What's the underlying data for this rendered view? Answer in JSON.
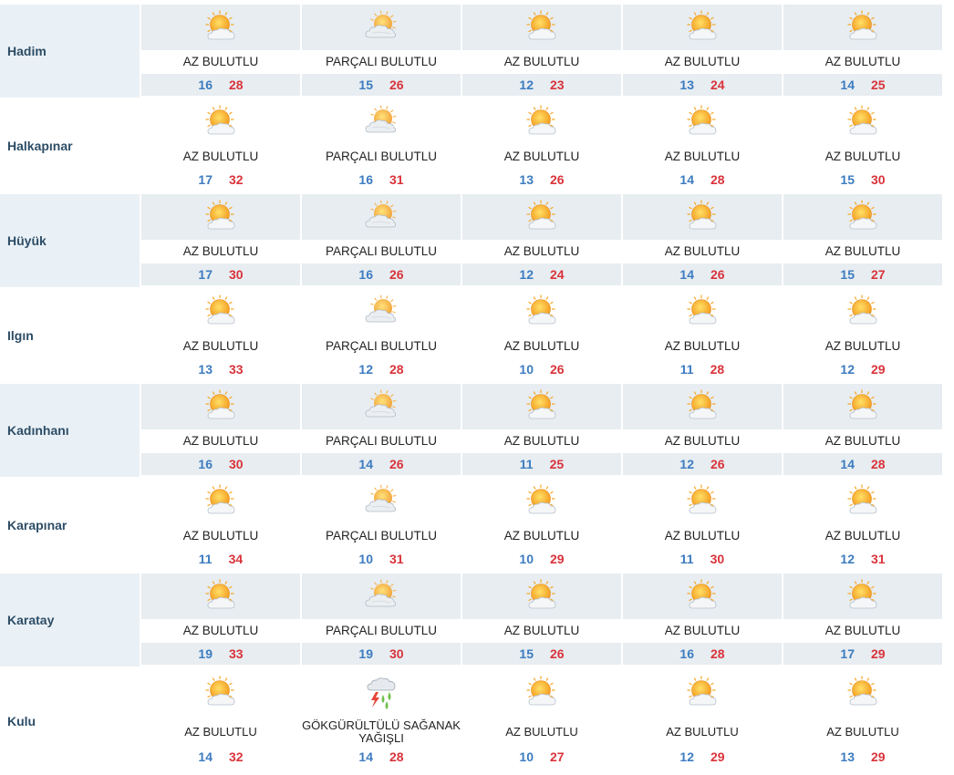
{
  "colors": {
    "min_temp": "#3d7cc0",
    "max_temp": "#d9333a",
    "city": "#2d4d66",
    "band": "#e7edf1"
  },
  "rows": [
    {
      "city": "Hadim",
      "days": [
        {
          "icon": "sun-cloud-icon",
          "desc": "AZ BULUTLU",
          "min": "16",
          "max": "28"
        },
        {
          "icon": "partly-cloudy-icon",
          "desc": "PARÇALI BULUTLU",
          "min": "15",
          "max": "26"
        },
        {
          "icon": "sun-cloud-icon",
          "desc": "AZ BULUTLU",
          "min": "12",
          "max": "23"
        },
        {
          "icon": "sun-cloud-icon",
          "desc": "AZ BULUTLU",
          "min": "13",
          "max": "24"
        },
        {
          "icon": "sun-cloud-icon",
          "desc": "AZ BULUTLU",
          "min": "14",
          "max": "25"
        }
      ]
    },
    {
      "city": "Halkapınar",
      "days": [
        {
          "icon": "sun-cloud-icon",
          "desc": "AZ BULUTLU",
          "min": "17",
          "max": "32"
        },
        {
          "icon": "partly-cloudy-icon",
          "desc": "PARÇALI BULUTLU",
          "min": "16",
          "max": "31"
        },
        {
          "icon": "sun-cloud-icon",
          "desc": "AZ BULUTLU",
          "min": "13",
          "max": "26"
        },
        {
          "icon": "sun-cloud-icon",
          "desc": "AZ BULUTLU",
          "min": "14",
          "max": "28"
        },
        {
          "icon": "sun-cloud-icon",
          "desc": "AZ BULUTLU",
          "min": "15",
          "max": "30"
        }
      ]
    },
    {
      "city": "Hüyük",
      "days": [
        {
          "icon": "sun-cloud-icon",
          "desc": "AZ BULUTLU",
          "min": "17",
          "max": "30"
        },
        {
          "icon": "partly-cloudy-icon",
          "desc": "PARÇALI BULUTLU",
          "min": "16",
          "max": "26"
        },
        {
          "icon": "sun-cloud-icon",
          "desc": "AZ BULUTLU",
          "min": "12",
          "max": "24"
        },
        {
          "icon": "sun-cloud-icon",
          "desc": "AZ BULUTLU",
          "min": "14",
          "max": "26"
        },
        {
          "icon": "sun-cloud-icon",
          "desc": "AZ BULUTLU",
          "min": "15",
          "max": "27"
        }
      ]
    },
    {
      "city": "Ilgın",
      "days": [
        {
          "icon": "sun-cloud-icon",
          "desc": "AZ BULUTLU",
          "min": "13",
          "max": "33"
        },
        {
          "icon": "partly-cloudy-icon",
          "desc": "PARÇALI BULUTLU",
          "min": "12",
          "max": "28"
        },
        {
          "icon": "sun-cloud-icon",
          "desc": "AZ BULUTLU",
          "min": "10",
          "max": "26"
        },
        {
          "icon": "sun-cloud-icon",
          "desc": "AZ BULUTLU",
          "min": "11",
          "max": "28"
        },
        {
          "icon": "sun-cloud-icon",
          "desc": "AZ BULUTLU",
          "min": "12",
          "max": "29"
        }
      ]
    },
    {
      "city": "Kadınhanı",
      "days": [
        {
          "icon": "sun-cloud-icon",
          "desc": "AZ BULUTLU",
          "min": "16",
          "max": "30"
        },
        {
          "icon": "partly-cloudy-icon",
          "desc": "PARÇALI BULUTLU",
          "min": "14",
          "max": "26"
        },
        {
          "icon": "sun-cloud-icon",
          "desc": "AZ BULUTLU",
          "min": "11",
          "max": "25"
        },
        {
          "icon": "sun-cloud-icon",
          "desc": "AZ BULUTLU",
          "min": "12",
          "max": "26"
        },
        {
          "icon": "sun-cloud-icon",
          "desc": "AZ BULUTLU",
          "min": "14",
          "max": "28"
        }
      ]
    },
    {
      "city": "Karapınar",
      "days": [
        {
          "icon": "sun-cloud-icon",
          "desc": "AZ BULUTLU",
          "min": "11",
          "max": "34"
        },
        {
          "icon": "partly-cloudy-icon",
          "desc": "PARÇALI BULUTLU",
          "min": "10",
          "max": "31"
        },
        {
          "icon": "sun-cloud-icon",
          "desc": "AZ BULUTLU",
          "min": "10",
          "max": "29"
        },
        {
          "icon": "sun-cloud-icon",
          "desc": "AZ BULUTLU",
          "min": "11",
          "max": "30"
        },
        {
          "icon": "sun-cloud-icon",
          "desc": "AZ BULUTLU",
          "min": "12",
          "max": "31"
        }
      ]
    },
    {
      "city": "Karatay",
      "days": [
        {
          "icon": "sun-cloud-icon",
          "desc": "AZ BULUTLU",
          "min": "19",
          "max": "33"
        },
        {
          "icon": "partly-cloudy-icon",
          "desc": "PARÇALI BULUTLU",
          "min": "19",
          "max": "30"
        },
        {
          "icon": "sun-cloud-icon",
          "desc": "AZ BULUTLU",
          "min": "15",
          "max": "26"
        },
        {
          "icon": "sun-cloud-icon",
          "desc": "AZ BULUTLU",
          "min": "16",
          "max": "28"
        },
        {
          "icon": "sun-cloud-icon",
          "desc": "AZ BULUTLU",
          "min": "17",
          "max": "29"
        }
      ]
    },
    {
      "city": "Kulu",
      "days": [
        {
          "icon": "sun-cloud-icon",
          "desc": "AZ BULUTLU",
          "min": "14",
          "max": "32"
        },
        {
          "icon": "thunderstorm-rain-icon",
          "desc": "GÖKGÜRÜLTÜLÜ SAĞANAK YAĞIŞLI",
          "min": "14",
          "max": "28"
        },
        {
          "icon": "sun-cloud-icon",
          "desc": "AZ BULUTLU",
          "min": "10",
          "max": "27"
        },
        {
          "icon": "sun-cloud-icon",
          "desc": "AZ BULUTLU",
          "min": "12",
          "max": "29"
        },
        {
          "icon": "sun-cloud-icon",
          "desc": "AZ BULUTLU",
          "min": "13",
          "max": "29"
        }
      ]
    }
  ]
}
